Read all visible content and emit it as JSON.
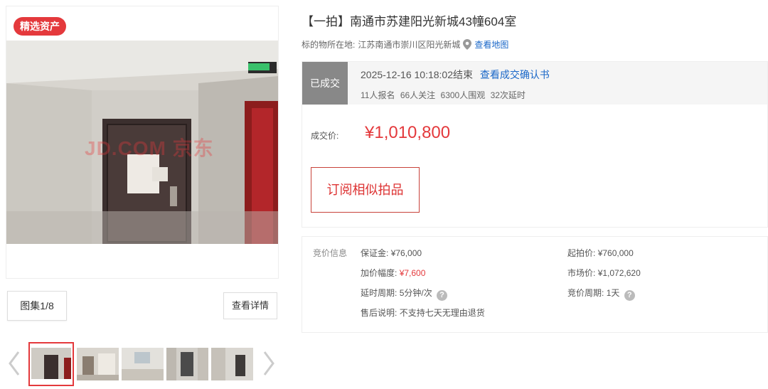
{
  "gallery": {
    "badge": "精选资产",
    "watermark": "JD.COM 京东",
    "album_label": "图集1/8",
    "detail_button": "查看详情",
    "thumb_count": 5
  },
  "item": {
    "title": "【一拍】南通市苏建阳光新城43幢604室",
    "location_label": "标的物所在地:",
    "location": "江苏南通市崇川区阳光新城",
    "map_link": "查看地图"
  },
  "status": {
    "tag": "已成交",
    "end_time": "2025-12-16 10:18:02结束",
    "confirm_link": "查看成交确认书",
    "signups": "11人报名",
    "followers": "66人关注",
    "viewers": "6300人围观",
    "extensions": "32次延时"
  },
  "deal": {
    "price_label": "成交价:",
    "price": "¥1,010,800",
    "subscribe_button": "订阅相似拍品"
  },
  "bid_info": {
    "title": "竞价信息",
    "deposit_label": "保证金:",
    "deposit": "¥76,000",
    "start_price_label": "起拍价:",
    "start_price": "¥760,000",
    "increment_label": "加价幅度:",
    "increment": "¥7,600",
    "market_price_label": "市场价:",
    "market_price": "¥1,072,620",
    "delay_period_label": "延时周期:",
    "delay_period": "5分钟/次",
    "bid_period_label": "竞价周期:",
    "bid_period": "1天",
    "after_sale_label": "售后说明:",
    "after_sale": "不支持七天无理由退货"
  },
  "colors": {
    "accent": "#e4393c",
    "link": "#1a67c8"
  }
}
